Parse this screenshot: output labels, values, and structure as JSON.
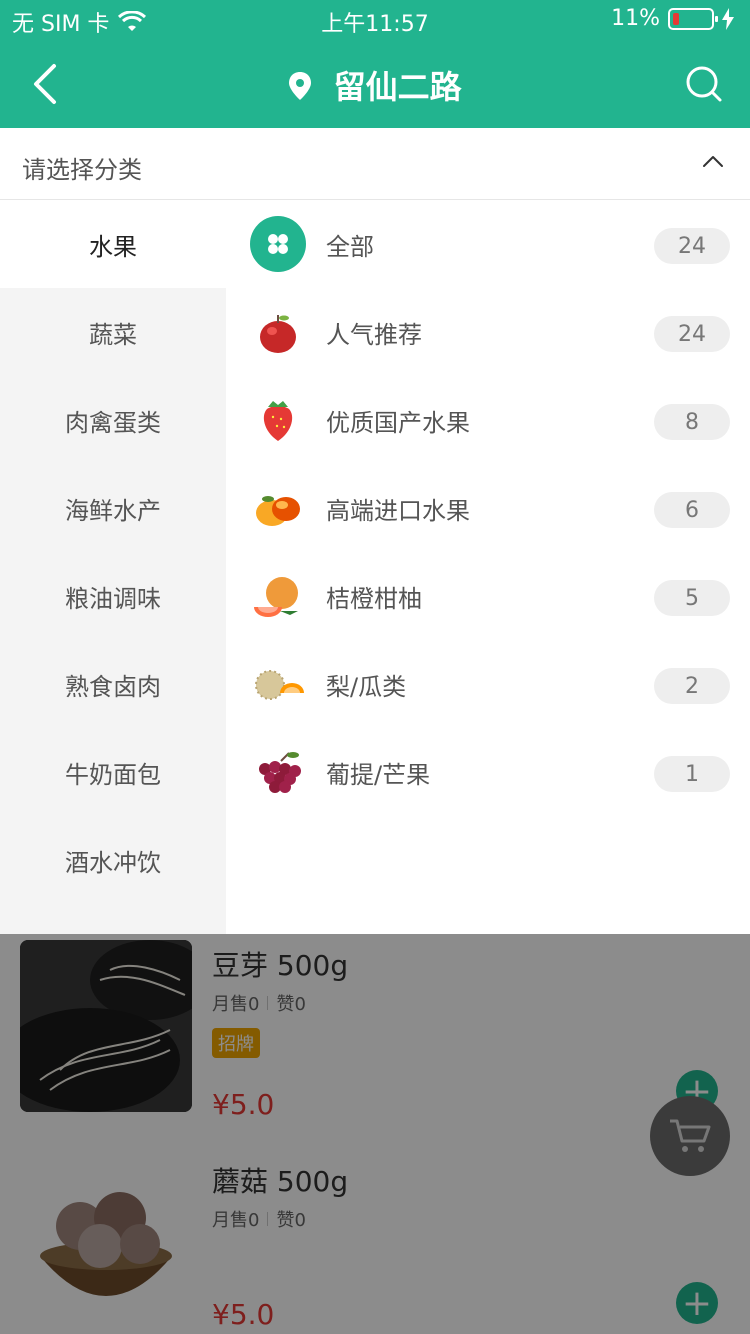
{
  "status": {
    "carrier": "无 SIM 卡",
    "time": "上午11:57",
    "battery": "11%"
  },
  "header": {
    "title": "留仙二路"
  },
  "category_bar": {
    "label": "请选择分类"
  },
  "sidebar": {
    "items": [
      {
        "label": "水果",
        "active": true
      },
      {
        "label": "蔬菜"
      },
      {
        "label": "肉禽蛋类"
      },
      {
        "label": "海鲜水产"
      },
      {
        "label": "粮油调味"
      },
      {
        "label": "熟食卤肉"
      },
      {
        "label": "牛奶面包"
      },
      {
        "label": "酒水冲饮"
      }
    ]
  },
  "subcategories": [
    {
      "label": "全部",
      "count": "24",
      "icon": "all-icon"
    },
    {
      "label": "人气推荐",
      "count": "24",
      "icon": "apple-icon"
    },
    {
      "label": "优质国产水果",
      "count": "8",
      "icon": "strawberry-icon"
    },
    {
      "label": "高端进口水果",
      "count": "6",
      "icon": "mango-icon"
    },
    {
      "label": "桔橙柑柚",
      "count": "5",
      "icon": "grapefruit-icon"
    },
    {
      "label": "梨/瓜类",
      "count": "2",
      "icon": "melon-icon"
    },
    {
      "label": "葡提/芒果",
      "count": "1",
      "icon": "grape-icon"
    }
  ],
  "products": [
    {
      "name": "豆芽 500g",
      "monthly_sales": "月售0",
      "likes": "赞0",
      "badge": "招牌",
      "price": "¥5.0"
    },
    {
      "name": "蘑菇 500g",
      "monthly_sales": "月售0",
      "likes": "赞0",
      "price": "¥5.0"
    }
  ],
  "colors": {
    "brand": "#22b48f",
    "price": "#e53935",
    "badge": "#f0a600"
  }
}
